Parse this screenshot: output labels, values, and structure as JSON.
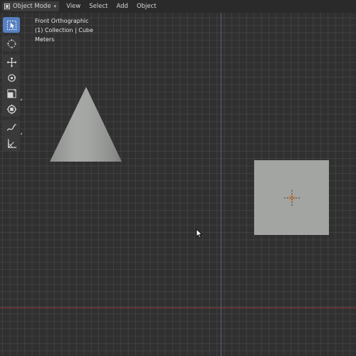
{
  "header": {
    "mode_label": "Object Mode",
    "menu": [
      "View",
      "Select",
      "Add",
      "Object"
    ]
  },
  "overlay": {
    "view_name": "Front Orthographic",
    "collection": "(1) Collection | Cube",
    "units": "Meters"
  },
  "toolbar": {
    "tools": [
      {
        "name": "select-box-tool",
        "icon": "select-box-icon",
        "active": true
      },
      {
        "name": "cursor-tool",
        "icon": "3d-cursor-icon",
        "active": false
      },
      {
        "name": "move-tool",
        "icon": "move-icon",
        "active": false
      },
      {
        "name": "rotate-tool",
        "icon": "rotate-icon",
        "active": false
      },
      {
        "name": "scale-tool",
        "icon": "scale-icon",
        "active": false
      },
      {
        "name": "transform-tool",
        "icon": "transform-icon",
        "active": false
      },
      {
        "name": "annotate-tool",
        "icon": "annotate-icon",
        "active": false
      },
      {
        "name": "measure-tool",
        "icon": "measure-icon",
        "active": false
      }
    ]
  },
  "scene": {
    "objects": [
      "Cone",
      "Cube"
    ],
    "colors": {
      "background": "#303030",
      "object": "#a3a5a3",
      "x_axis": "#8e3b3b",
      "y_axis": "#5c6d84",
      "active_tool": "#5680c2",
      "origin": "#e07a2e"
    }
  }
}
